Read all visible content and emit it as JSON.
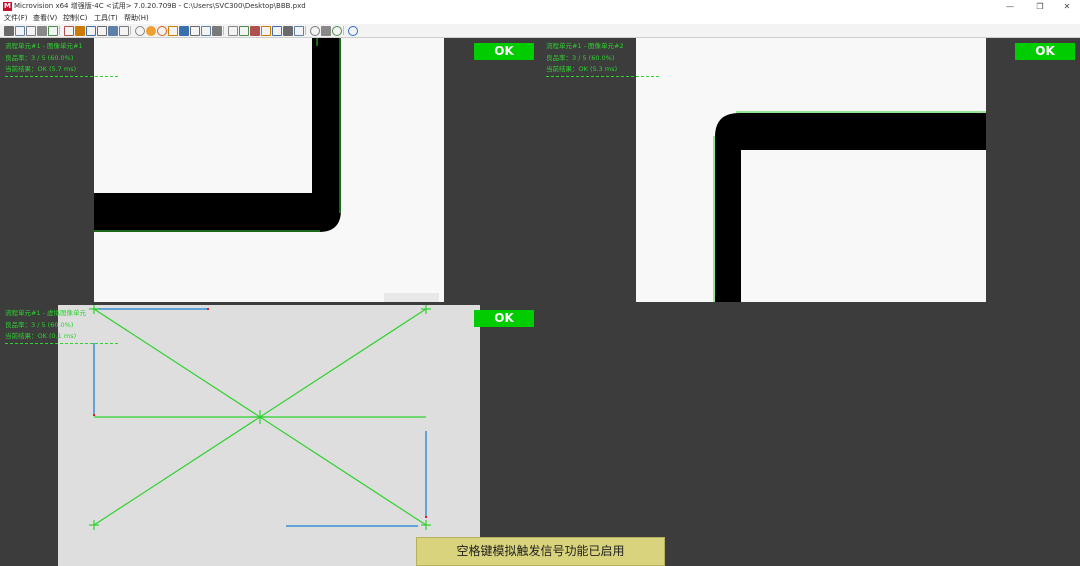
{
  "app": {
    "logo": "M",
    "title": "Microvision x64 增强版-4C <试用> 7.0.20.709B - C:\\Users\\SVC300\\Desktop\\BBB.pxd"
  },
  "window_controls": {
    "minimize": "—",
    "restore": "❐",
    "close": "✕"
  },
  "menu": [
    {
      "label": "文件(F)"
    },
    {
      "label": "查看(V)"
    },
    {
      "label": "控制(C)"
    },
    {
      "label": "工具(T)"
    },
    {
      "label": "帮助(H)"
    }
  ],
  "toolbar_icons": [
    "new-icon",
    "open-icon",
    "save-icon",
    "save-as-icon",
    "print-icon",
    "separator",
    "zoom-in-icon",
    "zoom-out-icon",
    "zoom-fit-icon",
    "zoom-actual-icon",
    "view-icon",
    "crosshair-icon",
    "separator",
    "play-icon",
    "pause-icon",
    "stop-icon",
    "roi-icon",
    "camera-icon",
    "image-icon",
    "color-icon",
    "tool-icon",
    "separator",
    "printer-icon",
    "settings-icon",
    "layers-icon",
    "grid-icon",
    "screenshot-icon",
    "export-icon",
    "disk-icon",
    "separator",
    "gear-icon",
    "pin-icon",
    "cog-icon",
    "separator",
    "info-icon"
  ],
  "panes": [
    {
      "ok": "OK",
      "line1": "流程单元#1 - 图像单元#1",
      "line2": "良品率：3 / 5 (60.0%)",
      "line3": "当前结果：OK (5.7 ms)"
    },
    {
      "ok": "OK",
      "line1": "流程单元#1 - 图像单元#2",
      "line2": "良品率：3 / 5 (60.0%)",
      "line3": "当前结果：OK (5.3 ms)"
    },
    {
      "ok": "OK",
      "line1": "流程单元#1 - 虚拟图像单元",
      "line2": "良品率：3 / 5 (60.0%)",
      "line3": "当前结果：OK (0.1 ms)"
    }
  ],
  "toast": "空格键模拟触发信号功能已启用",
  "colors": {
    "ok_green": "#00cc00",
    "overlay_green": "#2fd12f",
    "line_blue": "#3a8fd9",
    "background": "#3c3c3c",
    "toast": "#d8d37c"
  }
}
